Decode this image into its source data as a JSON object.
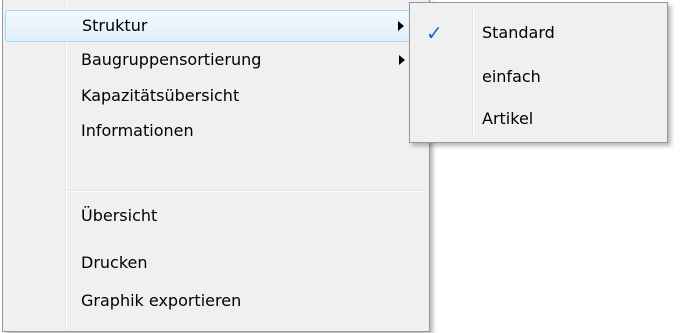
{
  "main_menu": {
    "items": [
      {
        "label": "Struktur"
      },
      {
        "label": "Baugruppensortierung"
      },
      {
        "label": "Kapazitätsübersicht"
      },
      {
        "label": "Informationen"
      },
      {
        "label": "Übersicht"
      },
      {
        "label": "Drucken"
      },
      {
        "label": "Graphik exportieren"
      }
    ]
  },
  "sub_menu": {
    "items": [
      {
        "label": "Standard",
        "checked": true
      },
      {
        "label": "einfach",
        "checked": false
      },
      {
        "label": "Artikel",
        "checked": false
      }
    ],
    "check_glyph": "✓",
    "check_color": "#1f63c4"
  },
  "colors": {
    "menu_bg": "#f0f0f0",
    "highlight_border": "#a8d8f0"
  }
}
